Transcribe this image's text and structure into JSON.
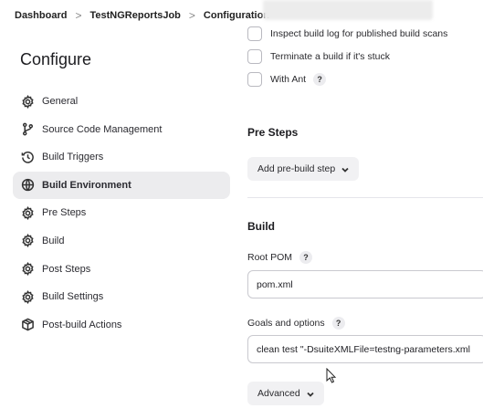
{
  "breadcrumb": {
    "items": [
      "Dashboard",
      "TestNGReportsJob",
      "Configuration"
    ],
    "separator": ">"
  },
  "page_title": "Configure",
  "sidebar": {
    "items": [
      {
        "label": "General",
        "icon": "gear-icon",
        "active": false
      },
      {
        "label": "Source Code Management",
        "icon": "branch-icon",
        "active": false
      },
      {
        "label": "Build Triggers",
        "icon": "clock-icon",
        "active": false
      },
      {
        "label": "Build Environment",
        "icon": "globe-icon",
        "active": true
      },
      {
        "label": "Pre Steps",
        "icon": "gear-icon",
        "active": false
      },
      {
        "label": "Build",
        "icon": "gear-icon",
        "active": false
      },
      {
        "label": "Post Steps",
        "icon": "gear-icon",
        "active": false
      },
      {
        "label": "Build Settings",
        "icon": "gear-icon",
        "active": false
      },
      {
        "label": "Post-build Actions",
        "icon": "package-icon",
        "active": false
      }
    ]
  },
  "build_env": {
    "checkboxes": [
      {
        "label": "Inspect build log for published build scans",
        "checked": false
      },
      {
        "label": "Terminate a build if it's stuck",
        "checked": false
      },
      {
        "label": "With Ant",
        "checked": false,
        "help": "?"
      }
    ]
  },
  "pre_steps": {
    "title": "Pre Steps",
    "add_button": "Add pre-build step"
  },
  "build": {
    "title": "Build",
    "root_pom_label": "Root POM",
    "root_pom_help": "?",
    "root_pom_value": "pom.xml",
    "goals_label": "Goals and options",
    "goals_help": "?",
    "goals_value": "clean test \"-DsuiteXMLFile=testng-parameters.xml",
    "advanced_button": "Advanced"
  },
  "colors": {
    "active_nav_bg": "#ececee",
    "input_border": "#c9c9cf",
    "button_bg": "#f1f1f3"
  }
}
